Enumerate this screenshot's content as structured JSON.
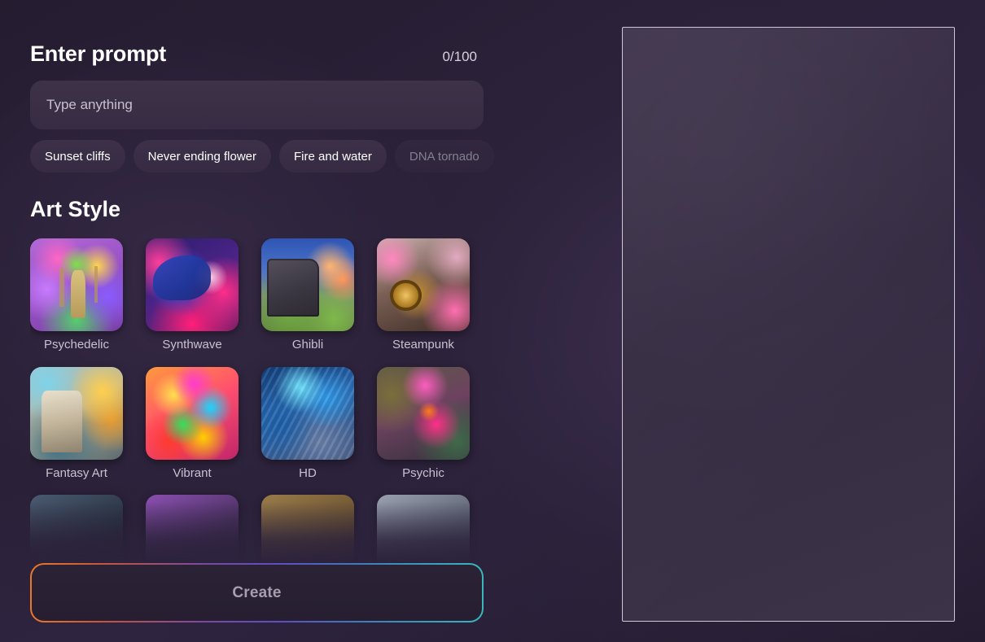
{
  "prompt": {
    "title": "Enter prompt",
    "char_count": "0/100",
    "input_value": "",
    "placeholder": "Type anything",
    "suggestions": [
      {
        "label": "Sunset cliffs",
        "faded": false
      },
      {
        "label": "Never ending flower",
        "faded": false
      },
      {
        "label": "Fire and water",
        "faded": false
      },
      {
        "label": "DNA tornado",
        "faded": true
      }
    ]
  },
  "art_style": {
    "title": "Art Style",
    "items": [
      {
        "label": "Psychedelic",
        "art": "art-psychedelic"
      },
      {
        "label": "Synthwave",
        "art": "art-synthwave"
      },
      {
        "label": "Ghibli",
        "art": "art-ghibli"
      },
      {
        "label": "Steampunk",
        "art": "art-steampunk"
      },
      {
        "label": "Fantasy Art",
        "art": "art-fantasy"
      },
      {
        "label": "Vibrant",
        "art": "art-vibrant"
      },
      {
        "label": "HD",
        "art": "art-hd"
      },
      {
        "label": "Psychic",
        "art": "art-psychic"
      },
      {
        "label": "",
        "art": "art-r3a"
      },
      {
        "label": "",
        "art": "art-r3b"
      },
      {
        "label": "",
        "art": "art-r3c"
      },
      {
        "label": "",
        "art": "art-r3d"
      }
    ]
  },
  "create_button": {
    "label": "Create"
  },
  "preview": {
    "content": ""
  },
  "colors": {
    "background": "#2b2139",
    "surface": "#3a2f46",
    "text_primary": "#ffffff",
    "text_muted": "#c7c2d0",
    "gradient_start": "#e8792a",
    "gradient_mid": "#5b4fc0",
    "gradient_end": "#39b7bd",
    "panel_border": "#cfc7d8"
  }
}
